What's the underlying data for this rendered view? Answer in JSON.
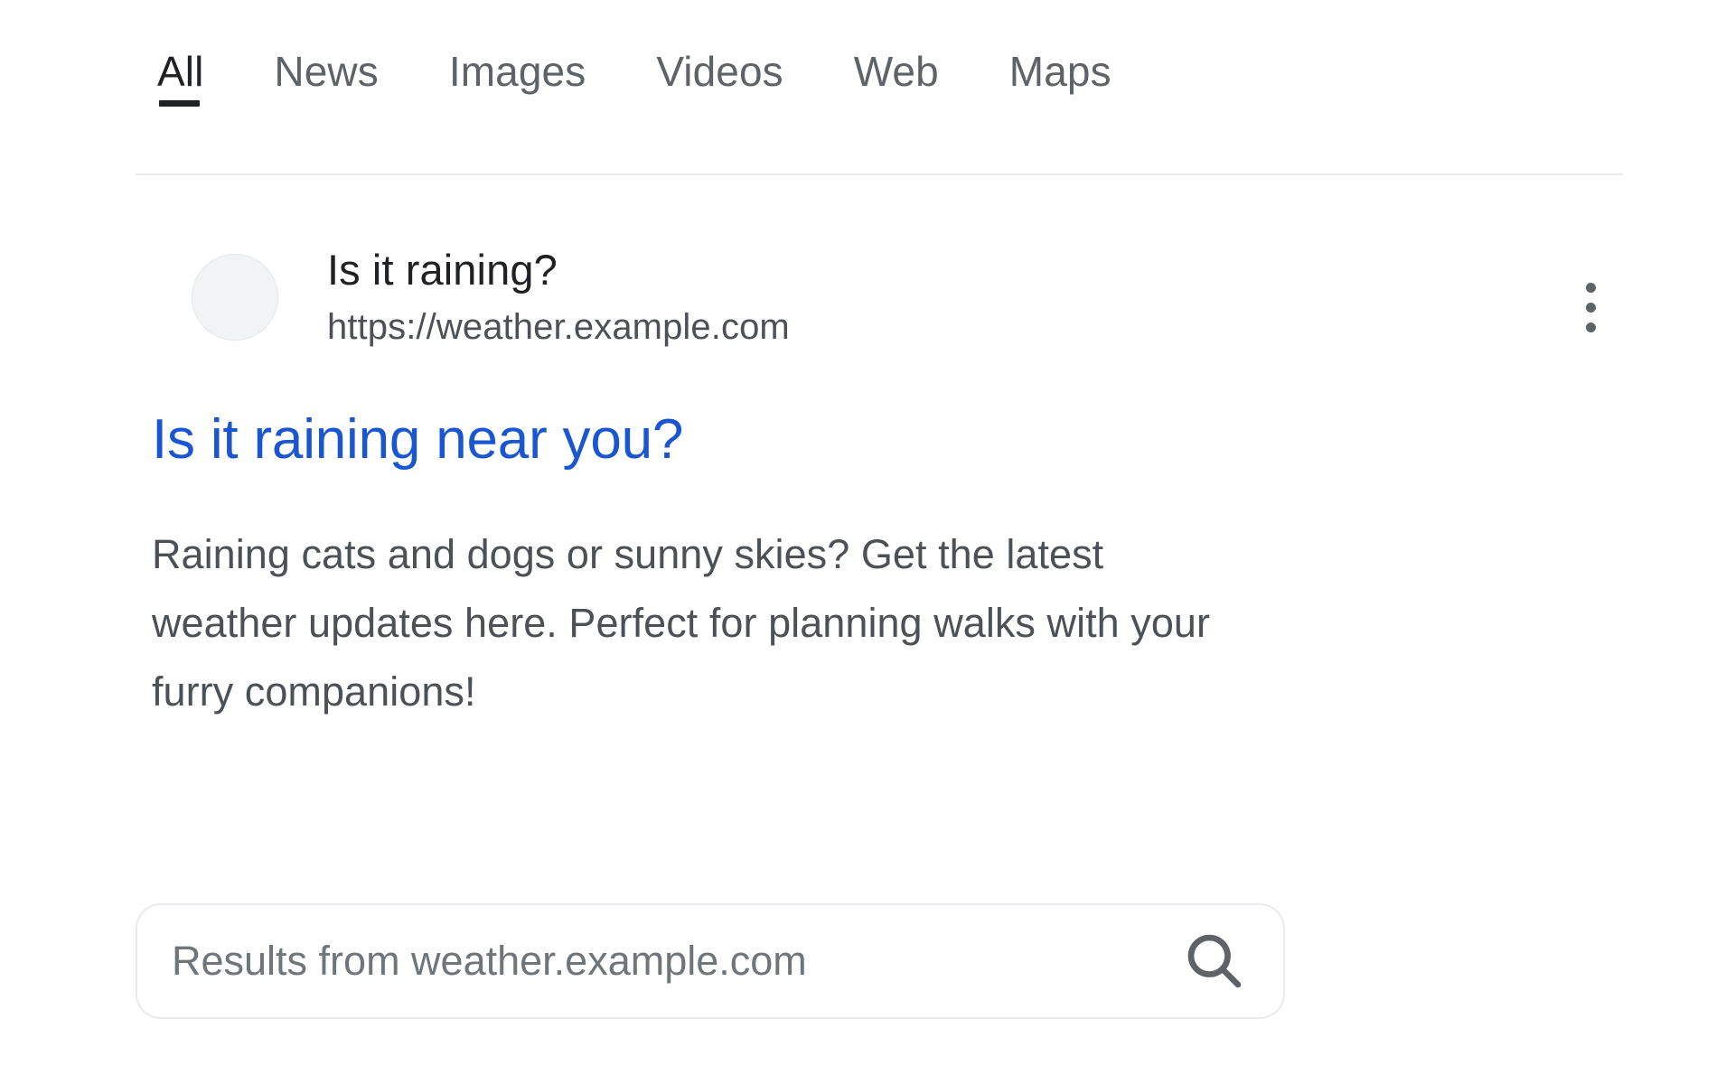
{
  "tabs": [
    {
      "label": "All",
      "active": true
    },
    {
      "label": "News",
      "active": false
    },
    {
      "label": "Images",
      "active": false
    },
    {
      "label": "Videos",
      "active": false
    },
    {
      "label": "Web",
      "active": false
    },
    {
      "label": "Maps",
      "active": false
    }
  ],
  "result": {
    "site_name": "Is it raining?",
    "site_url": "https://weather.example.com",
    "headline": "Is it raining near you?",
    "snippet": "Raining cats and dogs or sunny skies? Get the latest weather updates here. Perfect for planning walks with your furry companions!",
    "favicon": "blank-favicon",
    "more_options_icon": "kebab-menu-icon"
  },
  "site_search": {
    "placeholder": "Results from weather.example.com",
    "value": "",
    "search_icon": "search-icon"
  },
  "colors": {
    "link": "#1a56d0",
    "text_primary": "#202124",
    "text_secondary": "#4d5156",
    "tab_inactive": "#5f6368",
    "border": "#e8eaed",
    "background": "#ffffff"
  }
}
